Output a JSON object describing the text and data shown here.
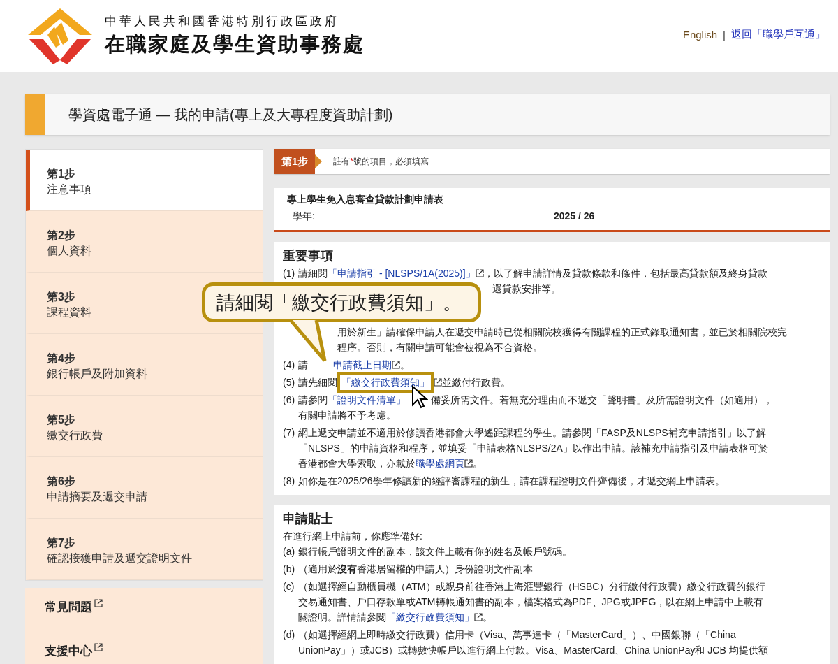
{
  "header": {
    "gov_line": "中華人民共和國香港特別行政區政府",
    "agency_name": "在職家庭及學生資助事務處",
    "language_link": "English",
    "separator": "|",
    "back_link": "返回「職學戶互通」"
  },
  "page_title": "學資處電子通 — 我的申請(專上及大專程度資助計劃)",
  "steps": [
    {
      "number": "第1步",
      "name": "注意事項",
      "selected": true
    },
    {
      "number": "第2步",
      "name": "個人資料",
      "selected": false
    },
    {
      "number": "第3步",
      "name": "課程資料",
      "selected": false
    },
    {
      "number": "第4步",
      "name": "銀行帳戶及附加資料",
      "selected": false
    },
    {
      "number": "第5步",
      "name": "繳交行政費",
      "selected": false
    },
    {
      "number": "第6步",
      "name": "申請摘要及遞交申請",
      "selected": false
    },
    {
      "number": "第7步",
      "name": "確認接獲申請及遞交證明文件",
      "selected": false
    }
  ],
  "side_links": [
    {
      "label": "常見問題"
    },
    {
      "label": "支援中心"
    }
  ],
  "step_bar": {
    "badge": "第1步",
    "note": [
      {
        "kind": "text",
        "text": "註有"
      },
      {
        "kind": "required",
        "text": "*"
      },
      {
        "kind": "text",
        "text": "號的項目，必須填寫"
      }
    ]
  },
  "form": {
    "title": "專上學生免入息審查貸款計劃申請表",
    "year_label": "學年:",
    "year_value": "2025 / 26"
  },
  "important": {
    "title": "重要事項",
    "callout": "請細閱「繳交行政費須知」。",
    "items": [
      {
        "label": "(1)",
        "lines": [
          {
            "segments": [
              {
                "kind": "text",
                "text": "請細閱"
              },
              {
                "kind": "link",
                "text": "「申請指引 - [NLSPS/1A(2025)]」",
                "external": true
              },
              {
                "kind": "text",
                "text": "，以了解申請詳情及貸款條款和條件，包括最高貸款額及終身貸款"
              }
            ]
          },
          {
            "kind": "bubble",
            "segments": [
              {
                "kind": "text",
                "text": "還貸款安排等。"
              }
            ]
          }
        ]
      },
      {
        "lines": [
          {
            "kind": "tail",
            "segments": [
              {
                "kind": "text",
                "text": "用於新生」請確保申請人在遞交申請時已從相關院校獲得有關課程的正式錄取通知書，並已於相關院校完"
              }
            ]
          },
          {
            "kind": "tail",
            "segments": [
              {
                "kind": "text",
                "text": "程序。否則，有關申請可能會被視為不合資格。"
              }
            ]
          }
        ]
      },
      {
        "label": "(4)",
        "lines": [
          {
            "segments": [
              {
                "kind": "text",
                "text": "請"
              },
              {
                "kind": "covered"
              },
              {
                "kind": "link",
                "text": "申請截止日期",
                "external": true
              },
              {
                "kind": "text",
                "text": "。"
              }
            ]
          }
        ]
      },
      {
        "label": "(5)",
        "lines": [
          {
            "segments": [
              {
                "kind": "text",
                "text": "請先細閱"
              },
              {
                "kind": "link",
                "text": "「繳交行政費須知」",
                "external": true,
                "highlighted": true
              },
              {
                "kind": "text",
                "text": "並繳付行政費。"
              }
            ]
          }
        ]
      },
      {
        "label": "(6)",
        "lines": [
          {
            "segments": [
              {
                "kind": "text",
                "text": "請參閱"
              },
              {
                "kind": "link",
                "text": "「證明文件清單」",
                "external": false
              },
              {
                "kind": "covered",
                "pointer": true
              },
              {
                "kind": "text",
                "text": "備妥所需文件。若無充分理由而不遞交「聲明書」及所需證明文件（如適用），"
              }
            ]
          },
          {
            "segments": [
              {
                "kind": "text",
                "text": "有關申請將不予考慮。"
              }
            ]
          }
        ]
      },
      {
        "label": "(7)",
        "lines": [
          {
            "segments": [
              {
                "kind": "text",
                "text": "網上遞交申請並不適用於修讀香港都會大學遙距課程的學生。請參閱「FASP及NLSPS補充申請指引」以了解"
              }
            ]
          },
          {
            "segments": [
              {
                "kind": "text",
                "text": "「NLSPS」的申請資格和程序，並填妥「申請表格NLSPS/2A」以作出申請。該補充申請指引及申請表格可於"
              }
            ]
          },
          {
            "segments": [
              {
                "kind": "text",
                "text": "香港都會大學索取，亦載於"
              },
              {
                "kind": "link",
                "text": "職學處網頁",
                "external": true
              },
              {
                "kind": "text",
                "text": "。"
              }
            ]
          }
        ]
      },
      {
        "label": "(8)",
        "lines": [
          {
            "segments": [
              {
                "kind": "text",
                "text": "如你是在2025/26學年修讀新的經評審課程的新生，請在課程證明文件齊備後，才遞交網上申請表。"
              }
            ]
          }
        ]
      }
    ]
  },
  "tips": {
    "title": "申請貼士",
    "intro": "在進行網上申請前，你應準備好:",
    "items": [
      {
        "label": "(a)",
        "lines": [
          {
            "segments": [
              {
                "kind": "text",
                "text": "銀行帳戶證明文件的副本，該文件上載有你的姓名及帳戶號碼。"
              }
            ]
          }
        ]
      },
      {
        "label": "(b)",
        "lines": [
          {
            "segments": [
              {
                "kind": "text",
                "text": "（適用於**沒有**香港居留權的申請人）身份證明文件副本"
              }
            ]
          }
        ]
      },
      {
        "label": "(c)",
        "lines": [
          {
            "segments": [
              {
                "kind": "text",
                "text": "（如選擇經自動櫃員機（ATM）或親身前往香港上海滙豐銀行（HSBC）分行繳付行政費）繳交行政費的銀行"
              }
            ]
          },
          {
            "segments": [
              {
                "kind": "text",
                "text": "交易通知書、戶口存款單或ATM轉帳通知書的副本，檔案格式為PDF、JPG或JPEG，以在網上申請中上載有"
              }
            ]
          },
          {
            "segments": [
              {
                "kind": "text",
                "text": "關證明。詳情請參閱"
              },
              {
                "kind": "link",
                "text": "「繳交行政費須知」",
                "external": true
              },
              {
                "kind": "text",
                "text": "。"
              }
            ]
          }
        ]
      },
      {
        "label": "(d)",
        "lines": [
          {
            "segments": [
              {
                "kind": "text",
                "text": "（如選擇經網上即時繳交行政費）信用卡（Visa、萬事達卡（「MasterCard」）、中國銀聯（「China"
              }
            ]
          },
          {
            "segments": [
              {
                "kind": "text",
                "text": "UnionPay」）或JCB）或轉數快帳戶以進行網上付款。Visa、MasterCard、China UnionPay和 JCB 均提供額"
              }
            ]
          }
        ]
      }
    ]
  }
}
